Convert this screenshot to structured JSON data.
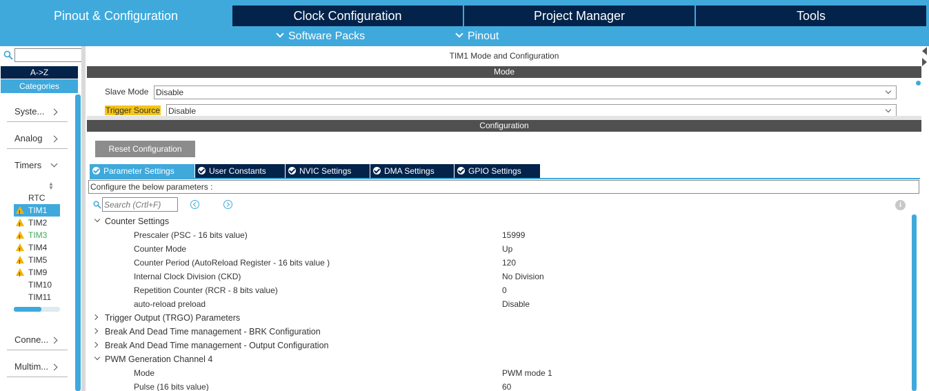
{
  "top_tabs": [
    {
      "label": "Pinout & Configuration"
    },
    {
      "label": "Clock Configuration"
    },
    {
      "label": "Project Manager"
    },
    {
      "label": "Tools"
    }
  ],
  "subbar": {
    "software_packs": "Software Packs",
    "pinout": "Pinout"
  },
  "sidebar": {
    "search_value": "",
    "az_label": "A->Z",
    "categories_label": "Categories",
    "categories": [
      {
        "label": "Syste..."
      },
      {
        "label": "Analog"
      },
      {
        "label": "Timers"
      },
      {
        "label": "Conne..."
      },
      {
        "label": "Multim..."
      }
    ],
    "timers": [
      {
        "label": "RTC",
        "warning": false,
        "selected": false,
        "status": "normal"
      },
      {
        "label": "TIM1",
        "warning": true,
        "selected": true,
        "status": "selected"
      },
      {
        "label": "TIM2",
        "warning": true,
        "selected": false,
        "status": "normal"
      },
      {
        "label": "TIM3",
        "warning": true,
        "selected": false,
        "status": "green"
      },
      {
        "label": "TIM4",
        "warning": true,
        "selected": false,
        "status": "normal"
      },
      {
        "label": "TIM5",
        "warning": true,
        "selected": false,
        "status": "normal"
      },
      {
        "label": "TIM9",
        "warning": true,
        "selected": false,
        "status": "normal"
      },
      {
        "label": "TIM10",
        "warning": false,
        "selected": false,
        "status": "normal"
      },
      {
        "label": "TIM11",
        "warning": false,
        "selected": false,
        "status": "normal"
      }
    ]
  },
  "main": {
    "title": "TIM1 Mode and Configuration",
    "mode_header": "Mode",
    "slave_mode": {
      "label": "Slave Mode",
      "value": "Disable"
    },
    "trigger_source": {
      "label": "Trigger Source",
      "value": "Disable"
    },
    "config_header": "Configuration",
    "reset_button": "Reset Configuration",
    "tabs": [
      {
        "label": "Parameter Settings",
        "active": true
      },
      {
        "label": "User Constants",
        "active": false
      },
      {
        "label": "NVIC Settings",
        "active": false
      },
      {
        "label": "DMA Settings",
        "active": false
      },
      {
        "label": "GPIO Settings",
        "active": false
      }
    ],
    "configure_text": "Configure the below parameters :",
    "search_placeholder": "Search (Crtl+F)",
    "info_glyph": "i",
    "tree": [
      {
        "type": "group",
        "label": "Counter Settings",
        "open": true
      },
      {
        "type": "param",
        "label": "Prescaler (PSC - 16 bits value)",
        "value": "15999"
      },
      {
        "type": "param",
        "label": "Counter Mode",
        "value": "Up"
      },
      {
        "type": "param",
        "label": "Counter Period (AutoReload Register - 16 bits value )",
        "value": "120"
      },
      {
        "type": "param",
        "label": "Internal Clock Division (CKD)",
        "value": "No Division"
      },
      {
        "type": "param",
        "label": "Repetition Counter (RCR - 8 bits value)",
        "value": "0"
      },
      {
        "type": "param",
        "label": "auto-reload preload",
        "value": "Disable"
      },
      {
        "type": "group",
        "label": "Trigger Output (TRGO) Parameters",
        "open": false
      },
      {
        "type": "group",
        "label": "Break And Dead Time management - BRK Configuration",
        "open": false
      },
      {
        "type": "group",
        "label": "Break And Dead Time management - Output Configuration",
        "open": false
      },
      {
        "type": "group",
        "label": "PWM Generation Channel 4",
        "open": true
      },
      {
        "type": "param",
        "label": "Mode",
        "value": "PWM mode 1"
      },
      {
        "type": "param",
        "label": "Pulse (16 bits value)",
        "value": "60"
      }
    ]
  },
  "colors": {
    "accent": "#3fa9dc",
    "dark": "#03234b",
    "section": "#505050",
    "highlight": "#f5c518",
    "warning": "#f4b400",
    "green": "#3dab54"
  }
}
